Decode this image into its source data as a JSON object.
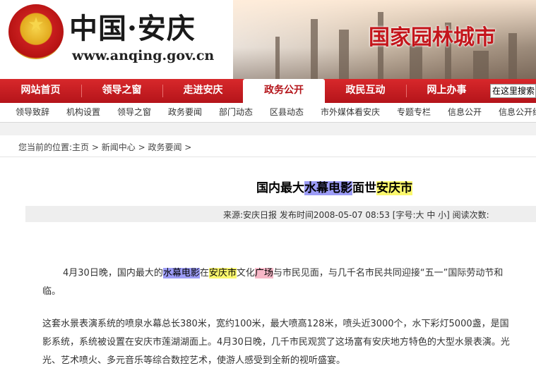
{
  "header": {
    "site_title": "中国·安庆",
    "site_url": "www.anqing.gov.cn",
    "slogan": "国家园林城市",
    "emblem_icon": "national-emblem-icon"
  },
  "main_nav": {
    "items": [
      "网站首页",
      "领导之窗",
      "走进安庆",
      "政务公开",
      "政民互动",
      "网上办事"
    ],
    "active": "政务公开",
    "search_value": "在这里搜索..."
  },
  "sub_nav": {
    "items": [
      "领导致辞",
      "机构设置",
      "领导之窗",
      "政务要闻",
      "部门动态",
      "区县动态",
      "市外媒体看安庆",
      "专题专栏",
      "信息公开",
      "信息公开线"
    ]
  },
  "breadcrumb": {
    "label": "您当前的位置:",
    "items": [
      "主页",
      "新闻中心",
      "政务要闻"
    ],
    "separator": " > "
  },
  "article": {
    "title_parts": [
      "国内最大",
      "水幕电影",
      "面世",
      "安庆市"
    ],
    "meta": "来源:安庆日报 发布时间2008-05-07 08:53 [字号:大 中 小] 阅读次数:",
    "p1": [
      "4月30日晚，国内最大的",
      "水幕电影",
      "在",
      "安庆市",
      "文化",
      "广场",
      "与市民见面，与几千名市民共同迎接“五一”国际劳动节和"
    ],
    "p1_line2": "临。",
    "p2_line1": "这套水景表演系统的喷泉水幕总长380米，宽约100米，最大喷高128米，喷头近3000个，水下彩灯5000盏，是国",
    "p2_line2": "影系统，系统被设置在安庆市莲湖湖面上。4月30日晚，几千市民观赏了这场富有安庆地方特色的大型水景表演。光",
    "p2_line3": "光、艺术喷火、多元音乐等综合数控艺术，使游人感受到全新的视听盛宴。"
  },
  "colors": {
    "brand_red": "#b4141a",
    "highlight_blue": "#9c9cf6",
    "highlight_yellow": "#fbf86d",
    "highlight_pink": "#f7b7c7"
  }
}
